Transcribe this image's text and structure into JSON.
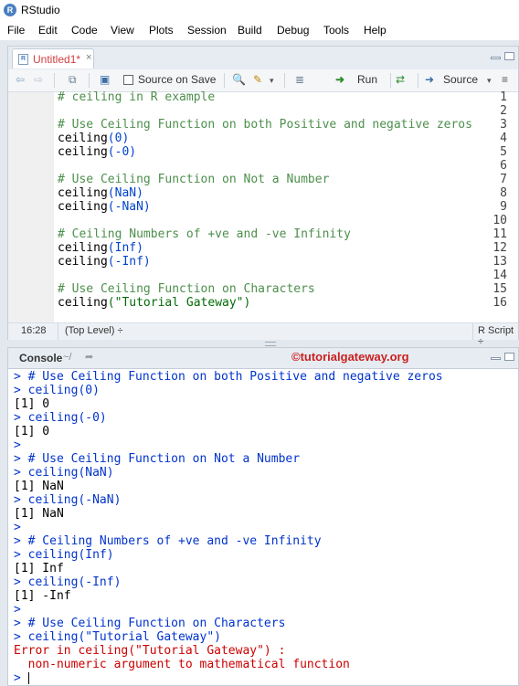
{
  "app": {
    "logo_letter": "R",
    "title": "RStudio"
  },
  "menu": [
    "File",
    "Edit",
    "Code",
    "View",
    "Plots",
    "Session",
    "Build",
    "Debug",
    "Tools",
    "Help"
  ],
  "editor": {
    "tab_label": "Untitled1*",
    "tab_close": "×",
    "toolbar": {
      "source_on_save": "Source on Save",
      "source_on_save_checked": false,
      "run": "Run",
      "source": "Source"
    },
    "lines": [
      {
        "n": "1",
        "text": "# ceiling in R example",
        "type": "comment"
      },
      {
        "n": "2",
        "text": "",
        "type": "blank"
      },
      {
        "n": "3",
        "text": "# Use Ceiling Function on both Positive and negative zeros",
        "type": "comment"
      },
      {
        "n": "4",
        "fn": "ceiling",
        "arg": "(0)"
      },
      {
        "n": "5",
        "fn": "ceiling",
        "arg": "(-0)"
      },
      {
        "n": "6",
        "text": "",
        "type": "blank"
      },
      {
        "n": "7",
        "text": "# Use Ceiling Function on Not a Number",
        "type": "comment"
      },
      {
        "n": "8",
        "fn": "ceiling",
        "arg": "(NaN)"
      },
      {
        "n": "9",
        "fn": "ceiling",
        "arg": "(-NaN)"
      },
      {
        "n": "10",
        "text": "",
        "type": "blank"
      },
      {
        "n": "11",
        "text": "# Ceiling Numbers of +ve and -ve Infinity",
        "type": "comment"
      },
      {
        "n": "12",
        "fn": "ceiling",
        "arg": "(Inf)"
      },
      {
        "n": "13",
        "fn": "ceiling",
        "arg": "(-Inf)"
      },
      {
        "n": "14",
        "text": "",
        "type": "blank"
      },
      {
        "n": "15",
        "text": "# Use Ceiling Function on Characters",
        "type": "comment"
      },
      {
        "n": "16",
        "fn": "ceiling",
        "arg": "(\"Tutorial Gateway\")"
      }
    ],
    "status": {
      "position": "16:28",
      "scope": "(Top Level) ÷",
      "filetype": "R Script ÷"
    }
  },
  "console": {
    "title": "Console",
    "path": "~/",
    "watermark": "©tutorialgateway.org",
    "lines": [
      {
        "kind": "in",
        "text": "> # Use Ceiling Function on both Positive and negative zeros"
      },
      {
        "kind": "in",
        "text": "> ceiling(0)"
      },
      {
        "kind": "out",
        "text": "[1] 0"
      },
      {
        "kind": "in",
        "text": "> ceiling(-0)"
      },
      {
        "kind": "out",
        "text": "[1] 0"
      },
      {
        "kind": "in",
        "text": ">"
      },
      {
        "kind": "in",
        "text": "> # Use Ceiling Function on Not a Number"
      },
      {
        "kind": "in",
        "text": "> ceiling(NaN)"
      },
      {
        "kind": "out",
        "text": "[1] NaN"
      },
      {
        "kind": "in",
        "text": "> ceiling(-NaN)"
      },
      {
        "kind": "out",
        "text": "[1] NaN"
      },
      {
        "kind": "in",
        "text": ">"
      },
      {
        "kind": "in",
        "text": "> # Ceiling Numbers of +ve and -ve Infinity"
      },
      {
        "kind": "in",
        "text": "> ceiling(Inf)"
      },
      {
        "kind": "out",
        "text": "[1] Inf"
      },
      {
        "kind": "in",
        "text": "> ceiling(-Inf)"
      },
      {
        "kind": "out",
        "text": "[1] -Inf"
      },
      {
        "kind": "in",
        "text": ">"
      },
      {
        "kind": "in",
        "text": "> # Use Ceiling Function on Characters"
      },
      {
        "kind": "in",
        "text": "> ceiling(\"Tutorial Gateway\")"
      },
      {
        "kind": "err",
        "text": "Error in ceiling(\"Tutorial Gateway\") :"
      },
      {
        "kind": "err",
        "text": "  non-numeric argument to mathematical function"
      },
      {
        "kind": "in",
        "text": "> "
      }
    ]
  },
  "colors": {
    "comment": "#4d8f4d",
    "input": "#0033cc",
    "error": "#cc0000",
    "watermark": "#cc1f1f"
  }
}
